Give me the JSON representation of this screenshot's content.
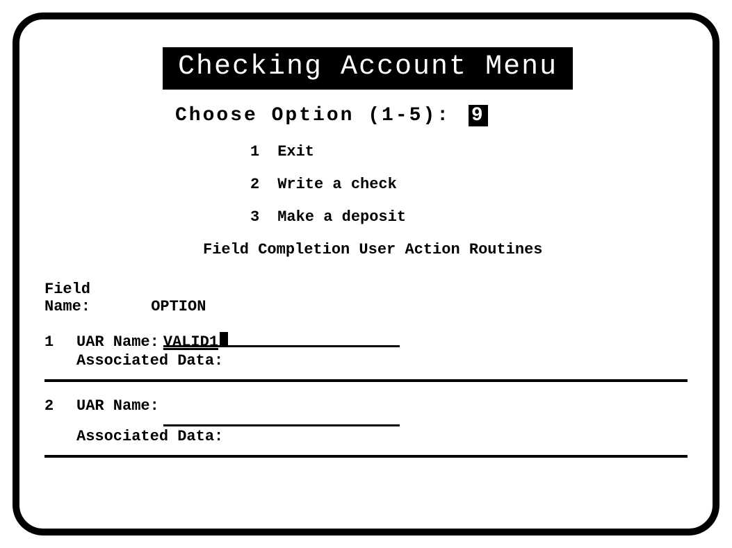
{
  "title": "Checking Account Menu",
  "prompt": {
    "label": "Choose Option (1-5):",
    "value": "9"
  },
  "menu": [
    {
      "num": "1",
      "label": "Exit"
    },
    {
      "num": "2",
      "label": "Write a check"
    },
    {
      "num": "3",
      "label": "Make a deposit"
    }
  ],
  "section_title": "Field Completion User Action Routines",
  "field_name": {
    "label": "Field Name:",
    "value": "OPTION"
  },
  "uar_label": "UAR Name:",
  "assoc_label": "Associated Data:",
  "uar": [
    {
      "idx": "1",
      "value": "VALID1"
    },
    {
      "idx": "2",
      "value": ""
    }
  ]
}
